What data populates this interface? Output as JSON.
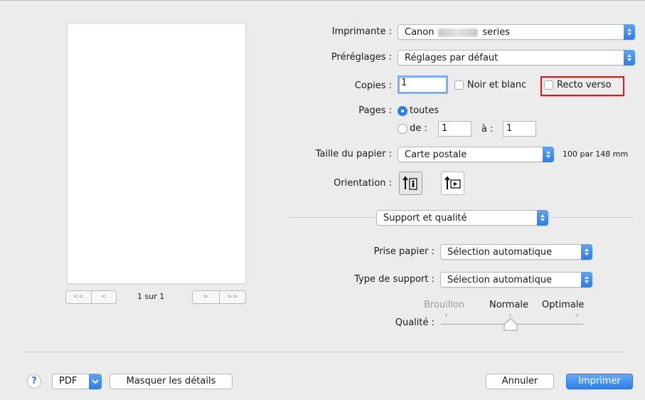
{
  "preview": {
    "page_count": "1 sur 1",
    "nav_first": "<<",
    "nav_prev": "<",
    "nav_next": ">",
    "nav_last": ">>"
  },
  "printer": {
    "label": "Imprimante :",
    "value_prefix": "Canon",
    "value_suffix": "series"
  },
  "presets": {
    "label": "Préréglages :",
    "value": "Réglages par défaut"
  },
  "copies": {
    "label": "Copies :",
    "value": "1",
    "bw_label": "Noir et blanc",
    "duplex_label": "Recto verso"
  },
  "pages": {
    "label": "Pages :",
    "all_label": "toutes",
    "from_label": "de :",
    "from_value": "1",
    "to_label": "à :",
    "to_value": "1"
  },
  "paper_size": {
    "label": "Taille du papier :",
    "value": "Carte postale",
    "dimensions": "100 par 148 mm"
  },
  "orientation": {
    "label": "Orientation :"
  },
  "section": {
    "value": "Support et qualité"
  },
  "paper_source": {
    "label": "Prise papier :",
    "value": "Sélection automatique"
  },
  "media_type": {
    "label": "Type de support :",
    "value": "Sélection automatique"
  },
  "quality": {
    "label": "Qualité :",
    "options": [
      "Brouillon",
      "Normale",
      "Optimale"
    ],
    "selected": "Normale"
  },
  "footer": {
    "help": "?",
    "pdf": "PDF",
    "hide_details": "Masquer les détails",
    "cancel": "Annuler",
    "print": "Imprimer"
  },
  "colors": {
    "accent": "#2e7de9",
    "highlight": "#e8111a"
  }
}
